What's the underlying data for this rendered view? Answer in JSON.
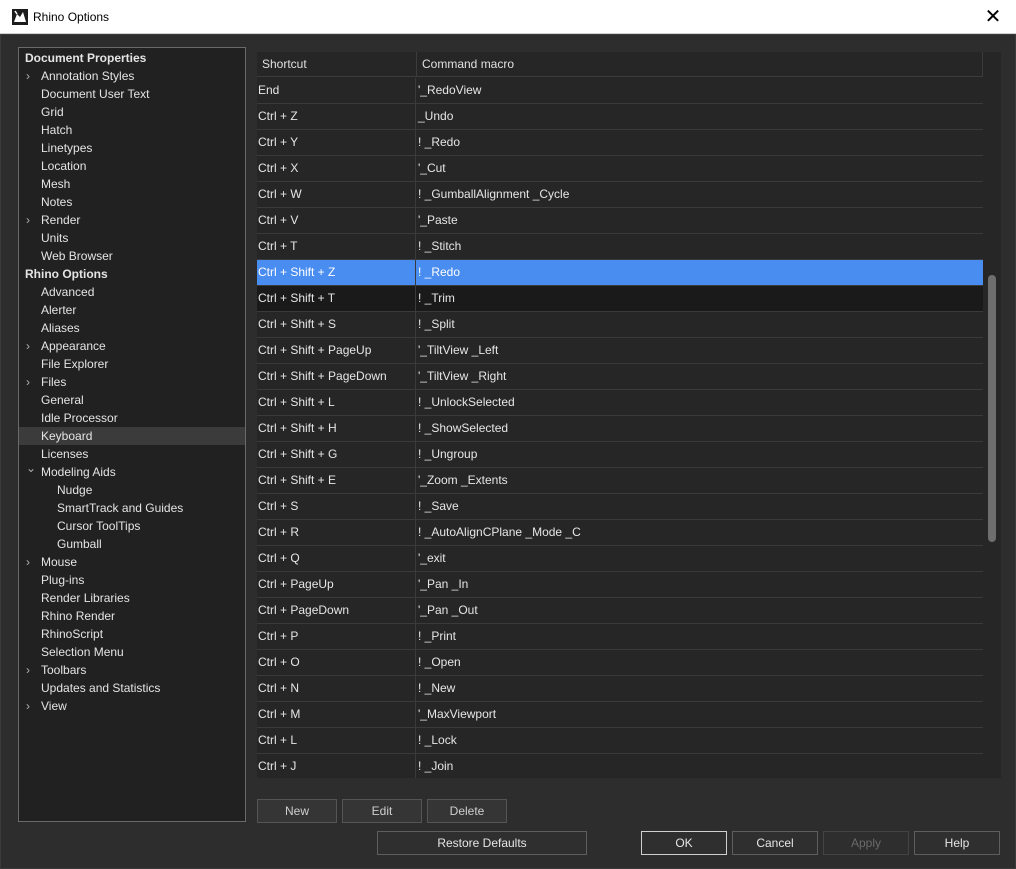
{
  "window": {
    "title": "Rhino Options",
    "close_glyph": "✕"
  },
  "tree": {
    "items": [
      {
        "label": "Document Properties",
        "level": 0,
        "section": true
      },
      {
        "label": "Annotation Styles",
        "level": 1,
        "expandable": true
      },
      {
        "label": "Document User Text",
        "level": 1
      },
      {
        "label": "Grid",
        "level": 1
      },
      {
        "label": "Hatch",
        "level": 1
      },
      {
        "label": "Linetypes",
        "level": 1
      },
      {
        "label": "Location",
        "level": 1
      },
      {
        "label": "Mesh",
        "level": 1
      },
      {
        "label": "Notes",
        "level": 1
      },
      {
        "label": "Render",
        "level": 1,
        "expandable": true
      },
      {
        "label": "Units",
        "level": 1
      },
      {
        "label": "Web Browser",
        "level": 1
      },
      {
        "label": "Rhino Options",
        "level": 0,
        "section": true
      },
      {
        "label": "Advanced",
        "level": 1
      },
      {
        "label": "Alerter",
        "level": 1
      },
      {
        "label": "Aliases",
        "level": 1
      },
      {
        "label": "Appearance",
        "level": 1,
        "expandable": true
      },
      {
        "label": "File Explorer",
        "level": 1
      },
      {
        "label": "Files",
        "level": 1,
        "expandable": true
      },
      {
        "label": "General",
        "level": 1
      },
      {
        "label": "Idle Processor",
        "level": 1
      },
      {
        "label": "Keyboard",
        "level": 1,
        "selected": true
      },
      {
        "label": "Licenses",
        "level": 1
      },
      {
        "label": "Modeling Aids",
        "level": 1,
        "expanded": true
      },
      {
        "label": "Nudge",
        "level": 2
      },
      {
        "label": "SmartTrack and Guides",
        "level": 2
      },
      {
        "label": "Cursor ToolTips",
        "level": 2
      },
      {
        "label": "Gumball",
        "level": 2
      },
      {
        "label": "Mouse",
        "level": 1,
        "expandable": true
      },
      {
        "label": "Plug-ins",
        "level": 1
      },
      {
        "label": "Render Libraries",
        "level": 1
      },
      {
        "label": "Rhino Render",
        "level": 1
      },
      {
        "label": "RhinoScript",
        "level": 1
      },
      {
        "label": "Selection Menu",
        "level": 1
      },
      {
        "label": "Toolbars",
        "level": 1,
        "expandable": true
      },
      {
        "label": "Updates and Statistics",
        "level": 1
      },
      {
        "label": "View",
        "level": 1,
        "expandable": true
      }
    ]
  },
  "grid": {
    "columns": [
      "Shortcut",
      "Command macro"
    ],
    "rows": [
      {
        "shortcut": "End",
        "macro": "'_RedoView"
      },
      {
        "shortcut": "Ctrl + Z",
        "macro": "_Undo"
      },
      {
        "shortcut": "Ctrl + Y",
        "macro": "! _Redo"
      },
      {
        "shortcut": "Ctrl + X",
        "macro": "'_Cut"
      },
      {
        "shortcut": "Ctrl + W",
        "macro": "! _GumballAlignment _Cycle"
      },
      {
        "shortcut": "Ctrl + V",
        "macro": "'_Paste"
      },
      {
        "shortcut": "Ctrl + T",
        "macro": "! _Stitch"
      },
      {
        "shortcut": "Ctrl + Shift + Z",
        "macro": "! _Redo",
        "selected": true
      },
      {
        "shortcut": "Ctrl + Shift + T",
        "macro": "! _Trim",
        "hover": true
      },
      {
        "shortcut": "Ctrl + Shift + S",
        "macro": "! _Split"
      },
      {
        "shortcut": "Ctrl + Shift + PageUp",
        "macro": "'_TiltView _Left"
      },
      {
        "shortcut": "Ctrl + Shift + PageDown",
        "macro": "'_TiltView _Right"
      },
      {
        "shortcut": "Ctrl + Shift + L",
        "macro": "! _UnlockSelected"
      },
      {
        "shortcut": "Ctrl + Shift + H",
        "macro": "! _ShowSelected"
      },
      {
        "shortcut": "Ctrl + Shift + G",
        "macro": "! _Ungroup"
      },
      {
        "shortcut": "Ctrl + Shift + E",
        "macro": "'_Zoom _Extents"
      },
      {
        "shortcut": "Ctrl + S",
        "macro": "! _Save"
      },
      {
        "shortcut": "Ctrl + R",
        "macro": "! _AutoAlignCPlane _Mode _C"
      },
      {
        "shortcut": "Ctrl + Q",
        "macro": "'_exit"
      },
      {
        "shortcut": "Ctrl + PageUp",
        "macro": "'_Pan _In"
      },
      {
        "shortcut": "Ctrl + PageDown",
        "macro": "'_Pan _Out"
      },
      {
        "shortcut": "Ctrl + P",
        "macro": "! _Print"
      },
      {
        "shortcut": "Ctrl + O",
        "macro": "! _Open"
      },
      {
        "shortcut": "Ctrl + N",
        "macro": "! _New"
      },
      {
        "shortcut": "Ctrl + M",
        "macro": "'_MaxViewport"
      },
      {
        "shortcut": "Ctrl + L",
        "macro": "! _Lock"
      },
      {
        "shortcut": "Ctrl + J",
        "macro": "! _Join"
      }
    ]
  },
  "buttons": {
    "new": "New",
    "edit": "Edit",
    "delete": "Delete",
    "restore_defaults": "Restore Defaults",
    "ok": "OK",
    "cancel": "Cancel",
    "apply": "Apply",
    "help": "Help"
  },
  "colors": {
    "selection": "#4a8df0",
    "background": "#2d2d2d",
    "panel": "#212121"
  }
}
